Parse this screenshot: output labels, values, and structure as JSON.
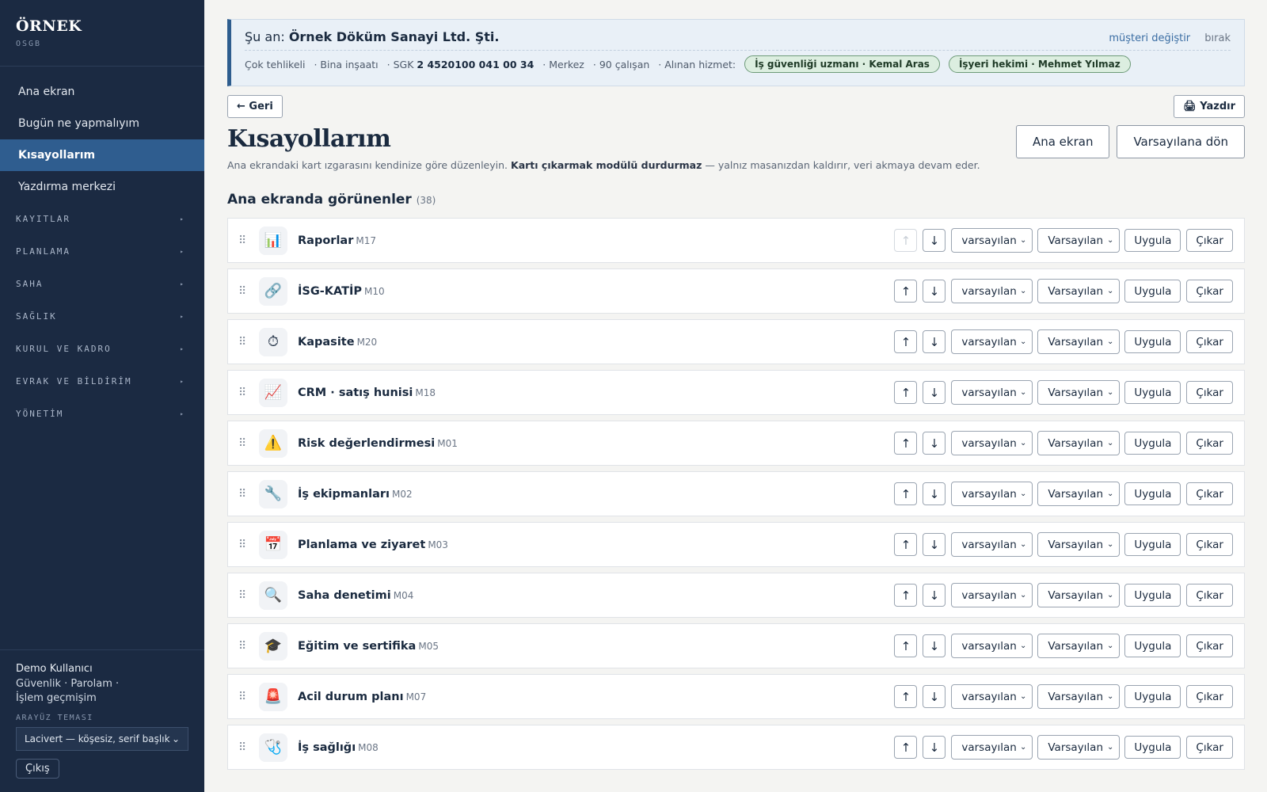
{
  "brand": {
    "name": "ÖRNEK",
    "sub": "OSGB"
  },
  "sidebar": {
    "items": [
      {
        "label": "Ana ekran",
        "name": "sidebar-item-ana-ekran"
      },
      {
        "label": "Bugün ne yapmalıyım",
        "name": "sidebar-item-bugun"
      },
      {
        "label": "Kısayollarım",
        "name": "sidebar-item-kisayollarim",
        "active": true
      },
      {
        "label": "Yazdırma merkezi",
        "name": "sidebar-item-yazdirma"
      }
    ],
    "groups": [
      {
        "label": "KAYITLAR",
        "name": "sidebar-group-kayitlar"
      },
      {
        "label": "PLANLAMA",
        "name": "sidebar-group-planlama"
      },
      {
        "label": "SAHA",
        "name": "sidebar-group-saha"
      },
      {
        "label": "SAĞLIK",
        "name": "sidebar-group-saglik"
      },
      {
        "label": "KURUL VE KADRO",
        "name": "sidebar-group-kurul"
      },
      {
        "label": "EVRAK VE BİLDİRİM",
        "name": "sidebar-group-evrak"
      },
      {
        "label": "YÖNETİM",
        "name": "sidebar-group-yonetim"
      }
    ],
    "group_arrow": "▸"
  },
  "user": {
    "name": "Demo Kullanıcı",
    "links": [
      "Güvenlik",
      "Parolam",
      "İşlem geçmişim"
    ],
    "theme_label": "ARAYÜZ TEMASI",
    "theme_value": "Lacivert — köşesiz, serif başlık",
    "logout": "Çıkış"
  },
  "client": {
    "prefix": "Şu an:",
    "name": "Örnek Döküm Sanayi Ltd. Şti.",
    "change": "müşteri değiştir",
    "leave": "bırak",
    "hazard": "Çok tehlikeli",
    "sector": "· Bina inşaatı",
    "sgk_label": "· SGK",
    "sgk": "2 4520100 041 00 34",
    "branch": "· Merkez",
    "employees": "· 90 çalışan",
    "service_label": "· Alınan hizmet:",
    "chips": [
      "İş güvenliği uzmanı · Kemal Aras",
      "İşyeri hekimi · Mehmet Yılmaz"
    ]
  },
  "toolbar": {
    "back": "← Geri",
    "print": "🖨 Yazdır"
  },
  "page": {
    "title": "Kısayollarım",
    "desc_pre": "Ana ekrandaki kart ızgarasını kendinize göre düzenleyin.",
    "desc_bold": "Kartı çıkarmak modülü durdurmaz",
    "desc_post": "— yalnız masanızdan kaldırır, veri akmaya devam eder.",
    "btn_home": "Ana ekran",
    "btn_reset": "Varsayılana dön"
  },
  "section": {
    "title": "Ana ekranda görünenler",
    "count": "(38)"
  },
  "row_controls": {
    "up": "↑",
    "down": "↓",
    "select1": "varsayılan",
    "select2": "Varsayılan",
    "apply": "Uygula",
    "remove": "Çıkar",
    "chevron": "⌄",
    "handle": "⠿"
  },
  "modules": [
    {
      "name": "Raporlar",
      "code": "M17",
      "icon": "chart-icon",
      "glyph": "📊",
      "up_disabled": true
    },
    {
      "name": "İSG-KATİP",
      "code": "M10",
      "icon": "link-icon",
      "glyph": "🔗"
    },
    {
      "name": "Kapasite",
      "code": "M20",
      "icon": "stopwatch-icon",
      "glyph": "⏱"
    },
    {
      "name": "CRM · satış hunisi",
      "code": "M18",
      "icon": "trend-chart-icon",
      "glyph": "📈"
    },
    {
      "name": "Risk değerlendirmesi",
      "code": "M01",
      "icon": "warning-icon",
      "glyph": "⚠️"
    },
    {
      "name": "İş ekipmanları",
      "code": "M02",
      "icon": "wrench-icon",
      "glyph": "🔧"
    },
    {
      "name": "Planlama ve ziyaret",
      "code": "M03",
      "icon": "calendar-icon",
      "glyph": "📅"
    },
    {
      "name": "Saha denetimi",
      "code": "M04",
      "icon": "magnifier-icon",
      "glyph": "🔍"
    },
    {
      "name": "Eğitim ve sertifika",
      "code": "M05",
      "icon": "graduation-cap-icon",
      "glyph": "🎓"
    },
    {
      "name": "Acil durum planı",
      "code": "M07",
      "icon": "siren-icon",
      "glyph": "🚨"
    },
    {
      "name": "İş sağlığı",
      "code": "M08",
      "icon": "stethoscope-icon",
      "glyph": "🩺"
    }
  ]
}
